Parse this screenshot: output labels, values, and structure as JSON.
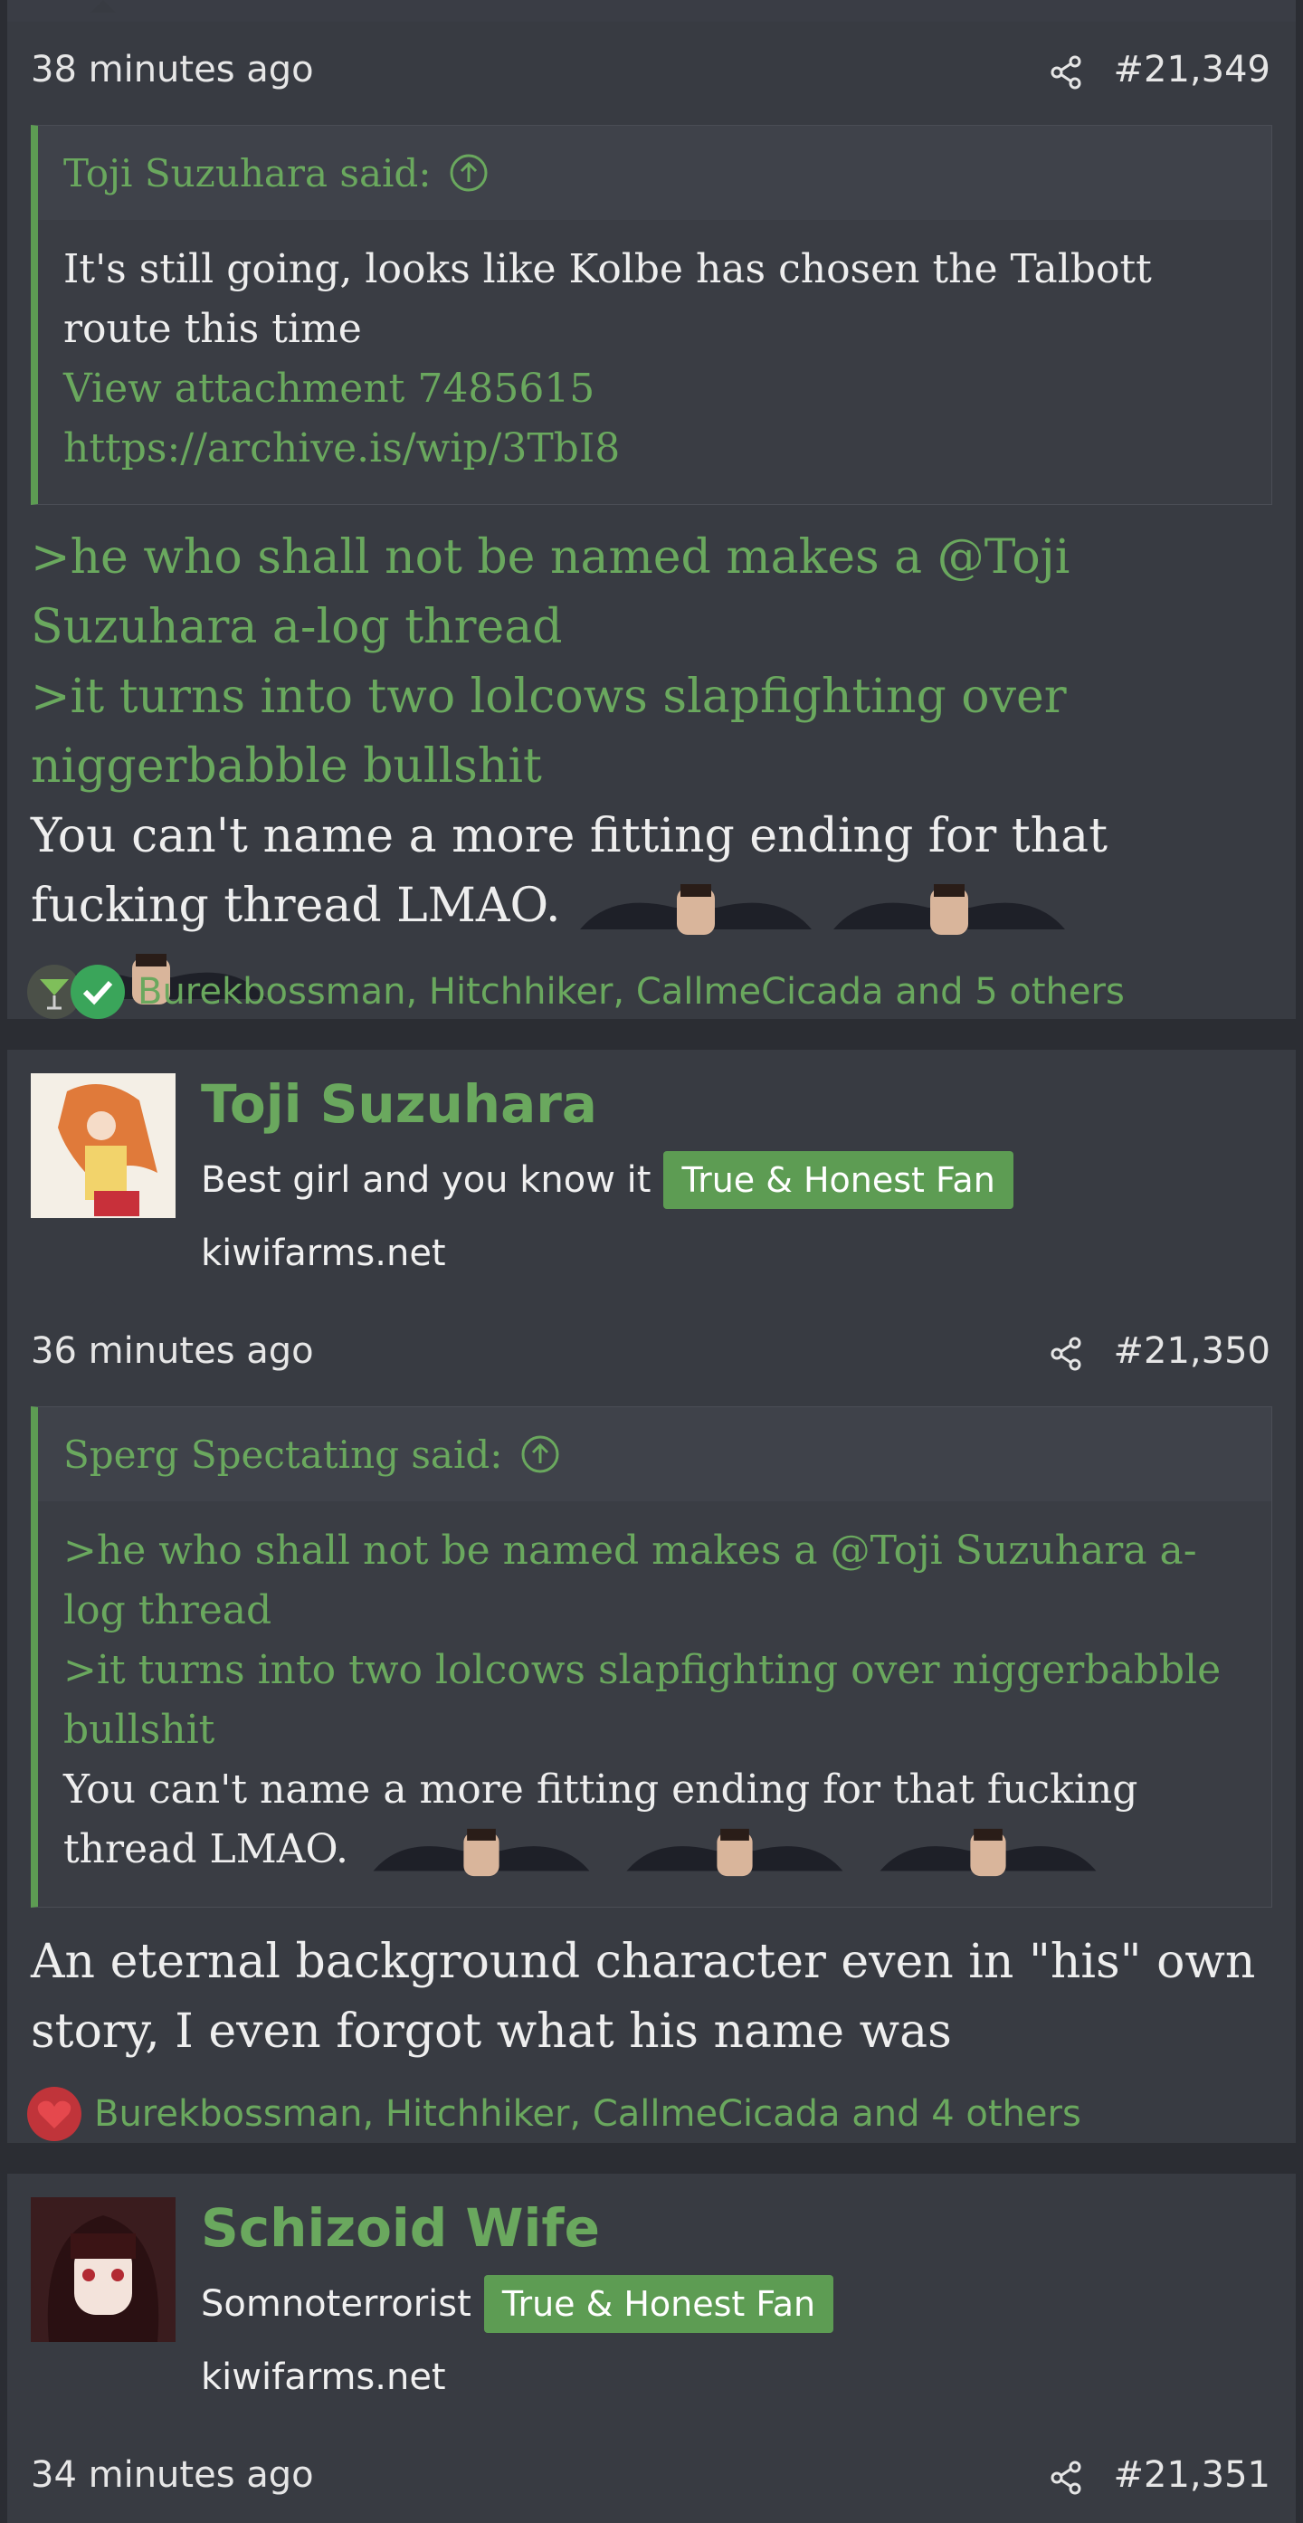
{
  "posts": [
    {
      "time": "38 minutes ago",
      "number": "#21,349",
      "quote": {
        "author": "Toji Suzuhara said:",
        "lines": [
          "It's still going, looks like Kolbe has chosen the Talbott route this time"
        ],
        "attachment": "View attachment 7485615",
        "link": "https://archive.is/wip/3TbI8"
      },
      "greentext": [
        ">he who shall not be named makes a @Toji Suzuhara a-log thread",
        ">it turns into two lolcows slapfighting over niggerbabble bullshit"
      ],
      "body": "You can't name a more fitting ending for that fucking thread LMAO.",
      "reactions": "Burekbossman, Hitchhiker, CallmeCicada and 5 others"
    },
    {
      "time": "36 minutes ago",
      "number": "#21,350",
      "quote": {
        "author": "Sperg Spectating said:",
        "greentext": [
          ">he who shall not be named makes a @Toji Suzuhara a-log thread",
          ">it turns into two lolcows slapfighting over niggerbabble bullshit"
        ],
        "body": "You can't name a more fitting ending for that fucking thread LMAO."
      },
      "body": "An eternal background character even in \"his\" own story, I even forgot what his name was",
      "reactions": "Burekbossman, Hitchhiker, CallmeCicada and 4 others"
    },
    {
      "time": "34 minutes ago",
      "number": "#21,351"
    }
  ],
  "users": [
    {
      "name": "Toji Suzuhara",
      "title": "Best girl and you know it",
      "badge": "True & Honest Fan",
      "site": "kiwifarms.net"
    },
    {
      "name": "Schizoid Wife",
      "title": "Somnoterrorist",
      "badge": "True & Honest Fan",
      "site": "kiwifarms.net"
    }
  ],
  "icons": {
    "share": "share-icon",
    "quote_up": "arrow-up-circle-icon",
    "reaction_drink": "cocktail-icon",
    "reaction_check": "checkmark-icon",
    "reaction_heart": "heart-icon"
  },
  "colors": {
    "accent_green": "#6aa85e",
    "badge_green": "#5d9c53",
    "page_bg": "#2b2d33",
    "block_bg": "#383b42"
  }
}
